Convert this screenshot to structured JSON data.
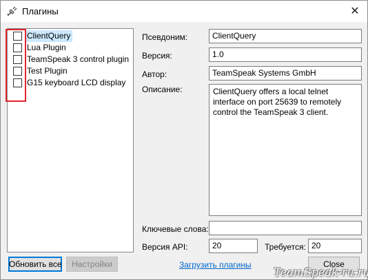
{
  "window": {
    "title": "Плагины",
    "close_glyph": "✕"
  },
  "plugins": [
    {
      "name": "ClientQuery",
      "checked": false,
      "selected": true
    },
    {
      "name": "Lua Plugin",
      "checked": false,
      "selected": false
    },
    {
      "name": "TeamSpeak 3 control plugin",
      "checked": false,
      "selected": false
    },
    {
      "name": "Test Plugin",
      "checked": false,
      "selected": false
    },
    {
      "name": "G15 keyboard LCD display",
      "checked": false,
      "selected": false
    }
  ],
  "details": {
    "alias_label": "Псевдоним:",
    "alias_value": "ClientQuery",
    "version_label": "Версия:",
    "version_value": "1.0",
    "author_label": "Автор:",
    "author_value": "TeamSpeak Systems GmbH",
    "description_label": "Описание:",
    "description_value": "ClientQuery offers a local telnet interface on port 25639 to remotely control the TeamSpeak 3 client.",
    "keywords_label": "Ключевые слова:",
    "keywords_value": "",
    "api_label": "Версия API:",
    "api_value": "20",
    "requires_label": "Требуется:",
    "requires_value": "20"
  },
  "buttons": {
    "refresh_all": "Обновить все",
    "settings": "Настройки",
    "load_plugins": "Загрузить плагины",
    "close": "Close"
  },
  "watermark": "TeamSpeak-ru.ru",
  "colors": {
    "highlight": "#e3242b",
    "selection": "#cce8ff",
    "link": "#0066cc"
  }
}
